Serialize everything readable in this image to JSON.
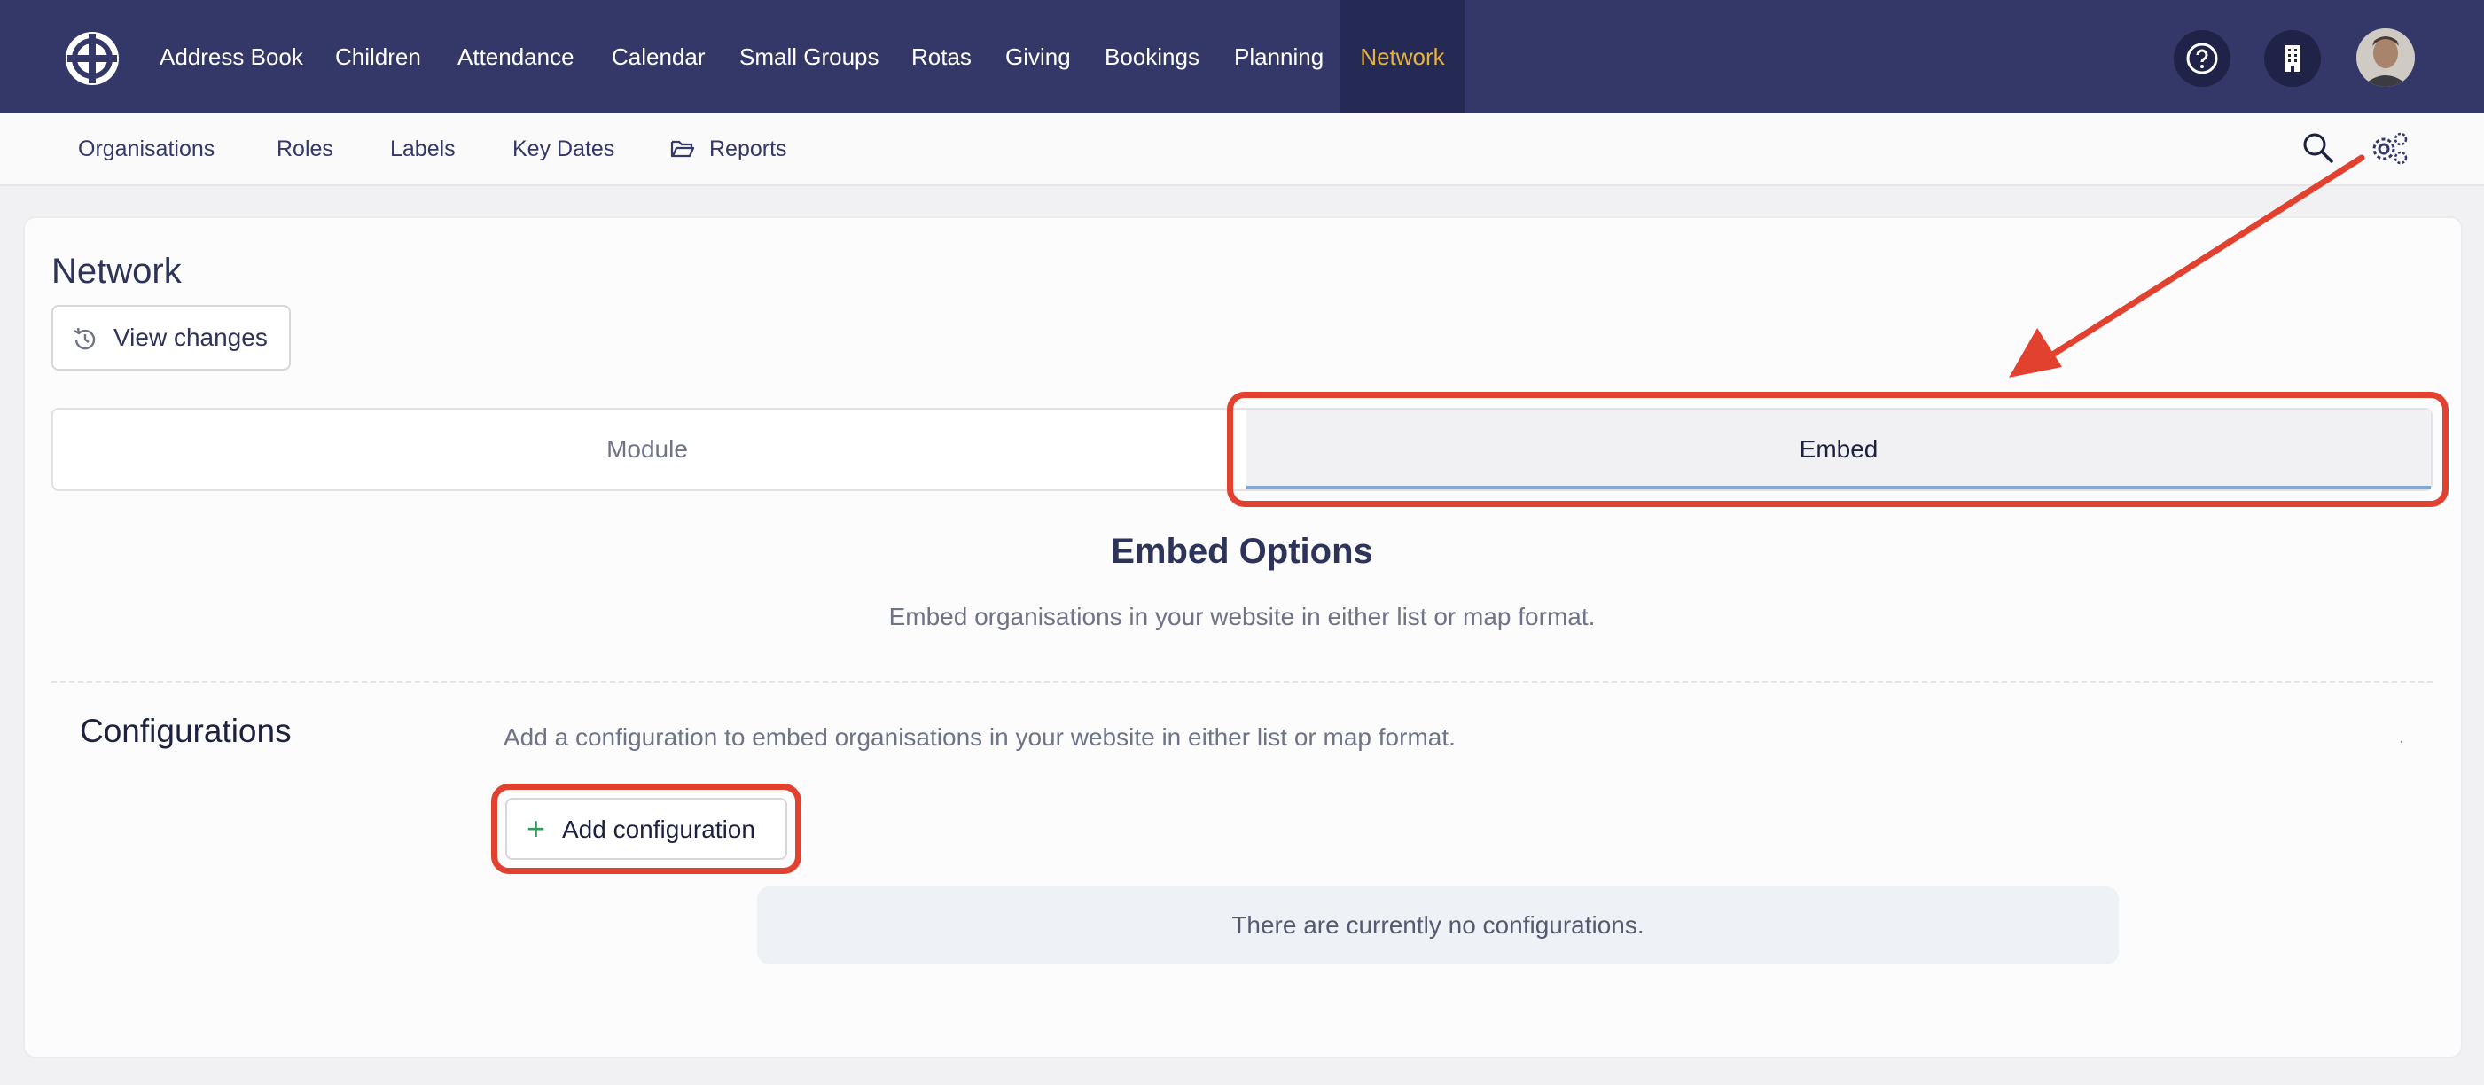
{
  "topnav": {
    "items": [
      {
        "label": "Address Book"
      },
      {
        "label": "Children"
      },
      {
        "label": "Attendance"
      },
      {
        "label": "Calendar"
      },
      {
        "label": "Small Groups"
      },
      {
        "label": "Rotas"
      },
      {
        "label": "Giving"
      },
      {
        "label": "Bookings"
      },
      {
        "label": "Planning"
      },
      {
        "label": "Network",
        "active": true
      }
    ],
    "icons": [
      "help-icon",
      "building-icon",
      "avatar"
    ],
    "active_color": "#e4b23e",
    "bg_color": "#343869"
  },
  "subnav": {
    "items": [
      {
        "label": "Organisations"
      },
      {
        "label": "Roles"
      },
      {
        "label": "Labels"
      },
      {
        "label": "Key Dates"
      },
      {
        "label": "Reports",
        "icon": "folder-open-icon"
      }
    ],
    "icons": [
      "search-icon",
      "settings-gears-icon"
    ]
  },
  "page": {
    "title": "Network",
    "view_changes_label": "View changes"
  },
  "tabs": [
    {
      "label": "Module",
      "active": false
    },
    {
      "label": "Embed",
      "active": true
    }
  ],
  "embed": {
    "title": "Embed Options",
    "subtitle": "Embed organisations in your website in either list or map format."
  },
  "configurations": {
    "title": "Configurations",
    "description": "Add a configuration to embed organisations in your website in either list or map format.",
    "dot": ".",
    "add_label": "Add configuration",
    "empty_message": "There are currently no configurations."
  },
  "annotation_color": "#e2412f"
}
